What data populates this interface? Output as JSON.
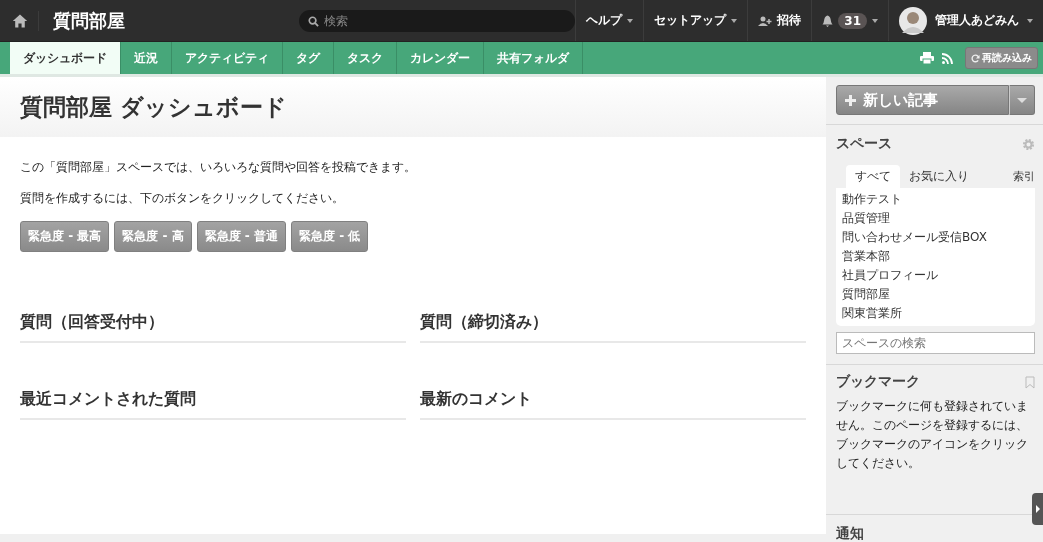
{
  "header": {
    "title": "質問部屋",
    "search": {
      "placeholder": "検索"
    },
    "menus": [
      {
        "label": "ヘルプ",
        "dropdown": true
      },
      {
        "label": "セットアップ",
        "dropdown": true
      },
      {
        "label": "招待",
        "dropdown": false
      }
    ],
    "notifications": {
      "count": "31"
    },
    "user": {
      "name": "管理人あどみん"
    }
  },
  "tabs": [
    {
      "label": "ダッシュボード",
      "selected": true
    },
    {
      "label": "近況",
      "selected": false
    },
    {
      "label": "アクティビティ",
      "selected": false
    },
    {
      "label": "タグ",
      "selected": false
    },
    {
      "label": "タスク",
      "selected": false
    },
    {
      "label": "カレンダー",
      "selected": false
    },
    {
      "label": "共有フォルダ",
      "selected": false
    }
  ],
  "toolbar": {
    "reload": "再読み込み"
  },
  "main": {
    "title": "質問部屋 ダッシュボード",
    "intro": [
      "この「質問部屋」スペースでは、いろいろな質問や回答を投稿できます。",
      "質問を作成するには、下のボタンをクリックしてください。"
    ],
    "buttons": [
      "緊急度 - 最高",
      "緊急度 - 高",
      "緊急度 - 普通",
      "緊急度 - 低"
    ],
    "sections": [
      "質問（回答受付中）",
      "質問（締切済み）",
      "最近コメントされた質問",
      "最新のコメント"
    ]
  },
  "sidebar": {
    "new_post": "新しい記事",
    "spaces": {
      "title": "スペース",
      "tabs": [
        {
          "label": "すべて",
          "selected": true
        },
        {
          "label": "お気に入り",
          "selected": false
        }
      ],
      "index": "索引",
      "items": [
        "動作テスト",
        "品質管理",
        "問い合わせメール受信BOX",
        "営業本部",
        "社員プロフィール",
        "質問部屋",
        "関東営業所"
      ],
      "search_placeholder": "スペースの検索"
    },
    "bookmarks": {
      "title": "ブックマーク",
      "text": "ブックマークに何も登録されていません。このページを登録するには、ブックマークのアイコンをクリックしてください。"
    },
    "notices": {
      "title": "通知"
    }
  }
}
